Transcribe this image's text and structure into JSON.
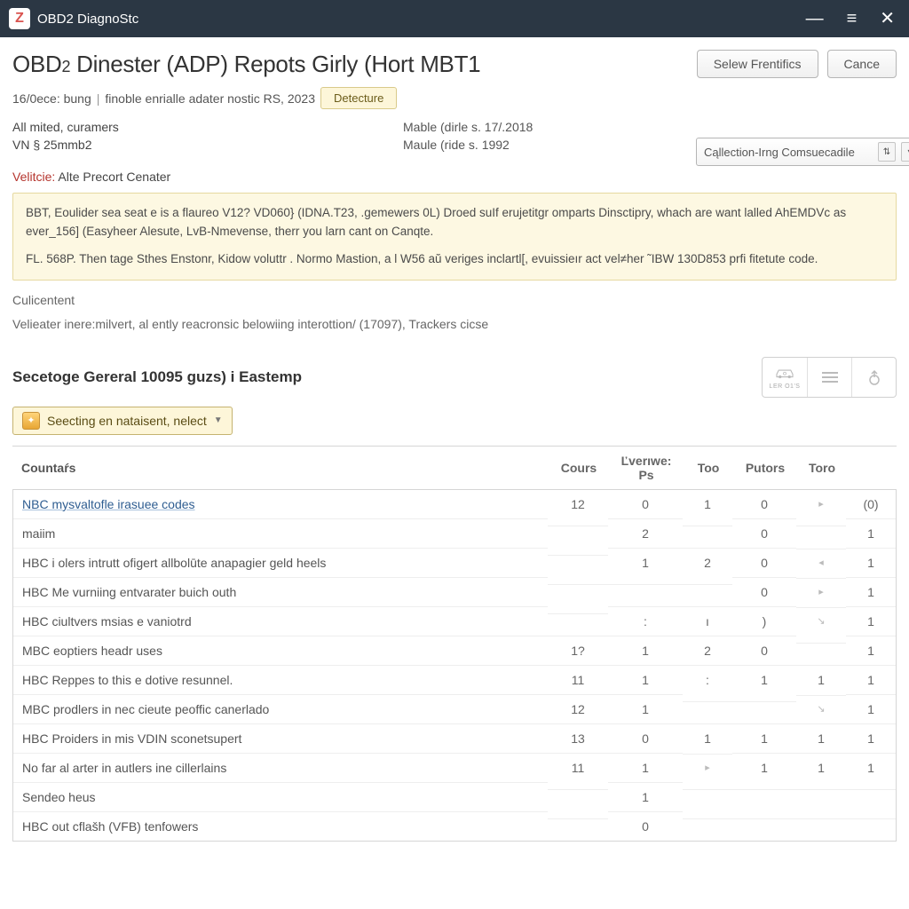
{
  "window": {
    "title": "OBD2 DiagnoStc",
    "logo_letter": "Z"
  },
  "header": {
    "title_pre": "OBD",
    "title_sub": "2",
    "title_rest": " Dinester (ADP) Repots Girly (Hort MBT1",
    "btn_select": "Selew Frentifics",
    "btn_cancel": "Cance"
  },
  "subline": {
    "left1": "16/0ece: bung",
    "left2": "finoble enrialle adater nostic RS, 2023",
    "detector": "Detecture"
  },
  "info": {
    "l1": "All mited, curamers",
    "l2": "VN § 25mmb2",
    "l3a": "Velitcie:",
    "l3b": " Alte Precort Cenater",
    "r1": "Mable (dirle s. 17/.2018",
    "r2": "Maule (ride s. 1992",
    "select_label": "Cąllection-Irng Comsuecadile"
  },
  "highlight": {
    "p1": "BBT, Eoulider sea seat e is a flaureo V12? VD060} (IDNA.T23, .gemewers 0L) Droed suIf erujetitgr omparts Dinsctipry, whach are want lalled AhEMDVc as ever_156] (Easyheer Alesute, LvB-Nmevense, therr you larn cant on Canqte.",
    "p2": "FL. 568P. Then tage Sthes Enstonr, Kidow voluttr . Normo Mastion, a l W56 aŭ veriges inclartl[, evuissieır act vel≠her ˜IBW 130D853 prfi fitetute code."
  },
  "mid": {
    "g1": "Culicentent",
    "g2": "Velieater inere:milvert, al ently reacronsic belowiing interottion/ (17097), Trackers cicse"
  },
  "section": {
    "title": "Secetoge Gereral 10095 guzs) i Eastemp",
    "selector": "Seecting en nataisent, nelect",
    "icon_cap1": "LER O1'S",
    "icon_cap2": ""
  },
  "table": {
    "headers": [
      "Countaŕs",
      "Cours",
      "Ľverıwe: Ps",
      "Too",
      "Putors",
      "Toro",
      ""
    ],
    "rows": [
      {
        "label": "NBC mysvaltofle irasuee codes",
        "link": true,
        "c": [
          "12",
          "0",
          "1",
          "0",
          "▸",
          "(0)"
        ]
      },
      {
        "label": "maiim",
        "link": false,
        "c": [
          "",
          "2",
          "",
          "0",
          "",
          "1"
        ]
      },
      {
        "label": "HBC i olers intrutt ofigert allbolūte anapagier geld heels",
        "link": false,
        "c": [
          "",
          "1",
          "2",
          "0",
          "◂",
          "1"
        ]
      },
      {
        "label": "HBC Me vurniing entvarater buich outh",
        "link": false,
        "c": [
          "",
          "",
          "",
          "0",
          "▸",
          "1"
        ]
      },
      {
        "label": "HBC ciultvers msias e vaniotrd",
        "link": false,
        "c": [
          "",
          ":",
          "ı",
          ")",
          "↘",
          "1"
        ]
      },
      {
        "label": "MBC eoptiers headr uses",
        "link": false,
        "c": [
          "1?",
          "1",
          "2",
          "0",
          "",
          "1"
        ]
      },
      {
        "label": "HBC Reppes to this e dotive resunnel.",
        "link": false,
        "c": [
          "11",
          "1",
          ":",
          "1",
          "1",
          "1"
        ]
      },
      {
        "label": "MBC prodlers in nec cieute peoffic canerlado",
        "link": false,
        "c": [
          "12",
          "1",
          "",
          "",
          "↘",
          "1"
        ]
      },
      {
        "label": "HBC Proiders in mis VDIN sconetsupert",
        "link": false,
        "c": [
          "13",
          "0",
          "1",
          "1",
          "1",
          "1"
        ]
      },
      {
        "label": "No far al arter in autlers ine cillerlains",
        "link": false,
        "c": [
          "11",
          "1",
          "▸",
          "1",
          "1",
          "1"
        ]
      },
      {
        "label": "Sendeo heus",
        "link": false,
        "c": [
          "",
          "1",
          "",
          "",
          "",
          ""
        ]
      },
      {
        "label": "HBC out cflašh (VFB) tenfowers",
        "link": false,
        "c": [
          "",
          "0",
          "",
          "",
          "",
          ""
        ]
      }
    ]
  }
}
